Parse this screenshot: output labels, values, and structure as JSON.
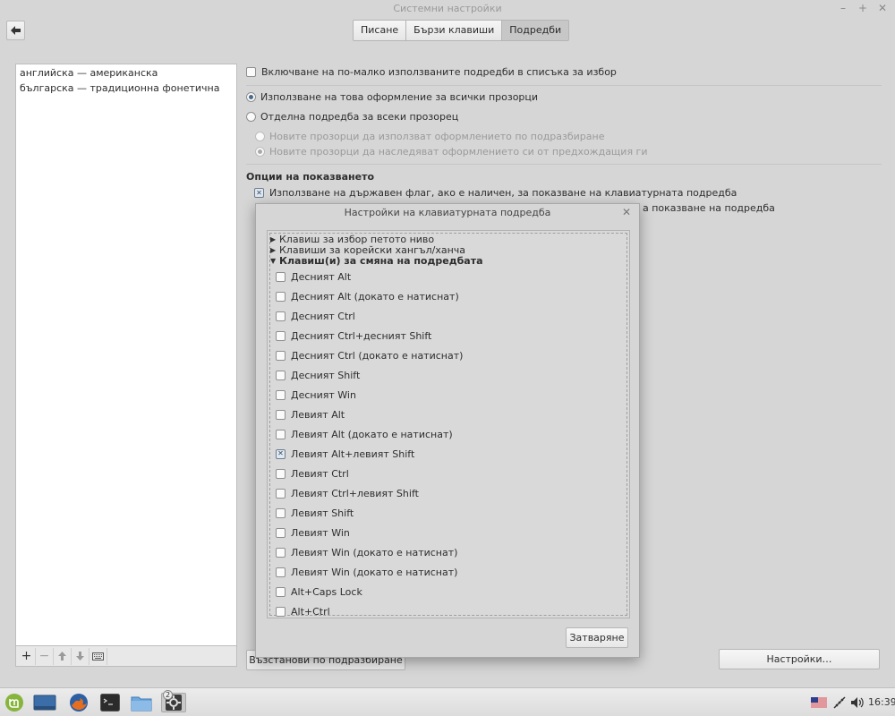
{
  "window": {
    "title": "Системни настройки",
    "tabs": [
      {
        "label": "Писане",
        "active": false
      },
      {
        "label": "Бързи клавиши",
        "active": false
      },
      {
        "label": "Подредби",
        "active": true
      }
    ]
  },
  "layouts": {
    "items": [
      "английска — американска",
      "българска — традиционна фонетична"
    ]
  },
  "options": {
    "show_less_used": "Включване на по-малко използваните подредби в списъка за избор",
    "same_layout_all": "Използване на това оформление за всички прозорци",
    "separate_layout": "Отделна подредба за всеки прозорец",
    "new_default": "Новите прозорци да използват оформлението по подразбиране",
    "new_inherit": "Новите прозорци да наследяват оформлението си от предхождащия ги",
    "display_title": "Опции на показването",
    "use_flag": "Използване на държавен флаг, ако е наличен, за показване на клавиатурната подредба",
    "use_flag_tail": "а показване на подредба"
  },
  "buttons": {
    "restore": "Възстанови по подразбиране",
    "settings": "Настройки…"
  },
  "dialog": {
    "title": "Настройки на клавиатурната подредба",
    "groups": [
      {
        "label": "Клавиш за избор петото ниво",
        "expanded": false
      },
      {
        "label": "Клавиши за корейски хангъл/ханча",
        "expanded": false
      },
      {
        "label": "Клавиш(и) за смяна на подредбата",
        "expanded": true
      }
    ],
    "items": [
      {
        "label": "Десният Alt",
        "checked": false
      },
      {
        "label": "Десният Alt (докато е натиснат)",
        "checked": false
      },
      {
        "label": "Десният Ctrl",
        "checked": false
      },
      {
        "label": "Десният Ctrl+десният Shift",
        "checked": false
      },
      {
        "label": "Десният Ctrl (докато е натиснат)",
        "checked": false
      },
      {
        "label": "Десният Shift",
        "checked": false
      },
      {
        "label": "Десният Win",
        "checked": false
      },
      {
        "label": "Левият Alt",
        "checked": false
      },
      {
        "label": "Левият Alt (докато е натиснат)",
        "checked": false
      },
      {
        "label": "Левият Alt+левият Shift",
        "checked": true
      },
      {
        "label": "Левият Ctrl",
        "checked": false
      },
      {
        "label": "Левият Ctrl+левият Shift",
        "checked": false
      },
      {
        "label": "Левият Shift",
        "checked": false
      },
      {
        "label": "Левият Win",
        "checked": false
      },
      {
        "label": "Левият Win (докато е натиснат)",
        "checked": false
      },
      {
        "label": "Левият Win (докато е натиснат)",
        "checked": false
      },
      {
        "label": "Alt+Caps Lock",
        "checked": false
      },
      {
        "label": "Alt+Ctrl",
        "checked": false
      }
    ],
    "close_label": "Затваряне"
  },
  "taskbar": {
    "clock": "16:39",
    "badge": "2"
  }
}
